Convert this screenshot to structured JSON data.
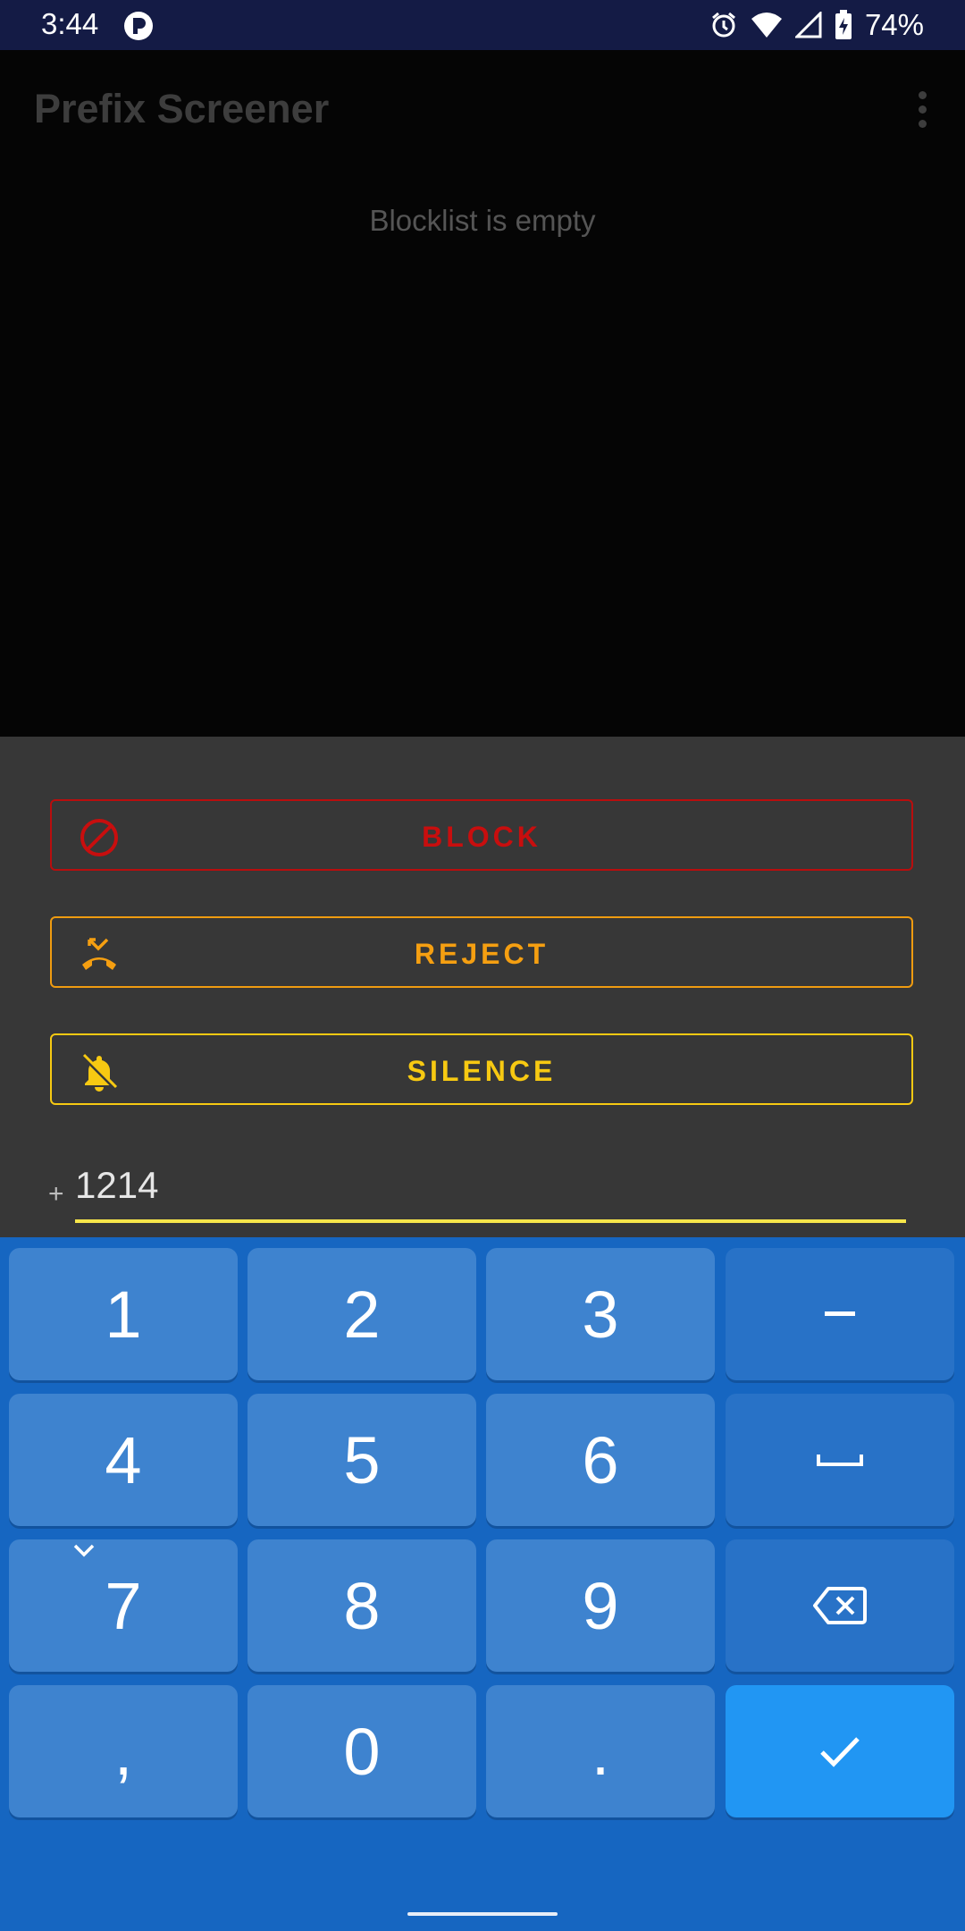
{
  "status_bar": {
    "time": "3:44",
    "battery": "74%"
  },
  "app_bar": {
    "title": "Prefix Screener"
  },
  "list": {
    "empty_message": "Blocklist is empty"
  },
  "sheet": {
    "actions": {
      "block": "BLOCK",
      "reject": "REJECT",
      "silence": "SILENCE"
    },
    "prefix_symbol": "+",
    "number": "1214"
  },
  "keypad": {
    "keys": [
      "1",
      "2",
      "3",
      "-",
      "4",
      "5",
      "6",
      "␣",
      "7",
      "8",
      "9",
      "backspace",
      ",",
      "0",
      ".",
      "done"
    ]
  },
  "colors": {
    "block": "#c80e0e",
    "reject": "#f59f11",
    "silence": "#f7c912",
    "accent_underline": "#f7e64a",
    "keyboard": "#1666c1"
  }
}
